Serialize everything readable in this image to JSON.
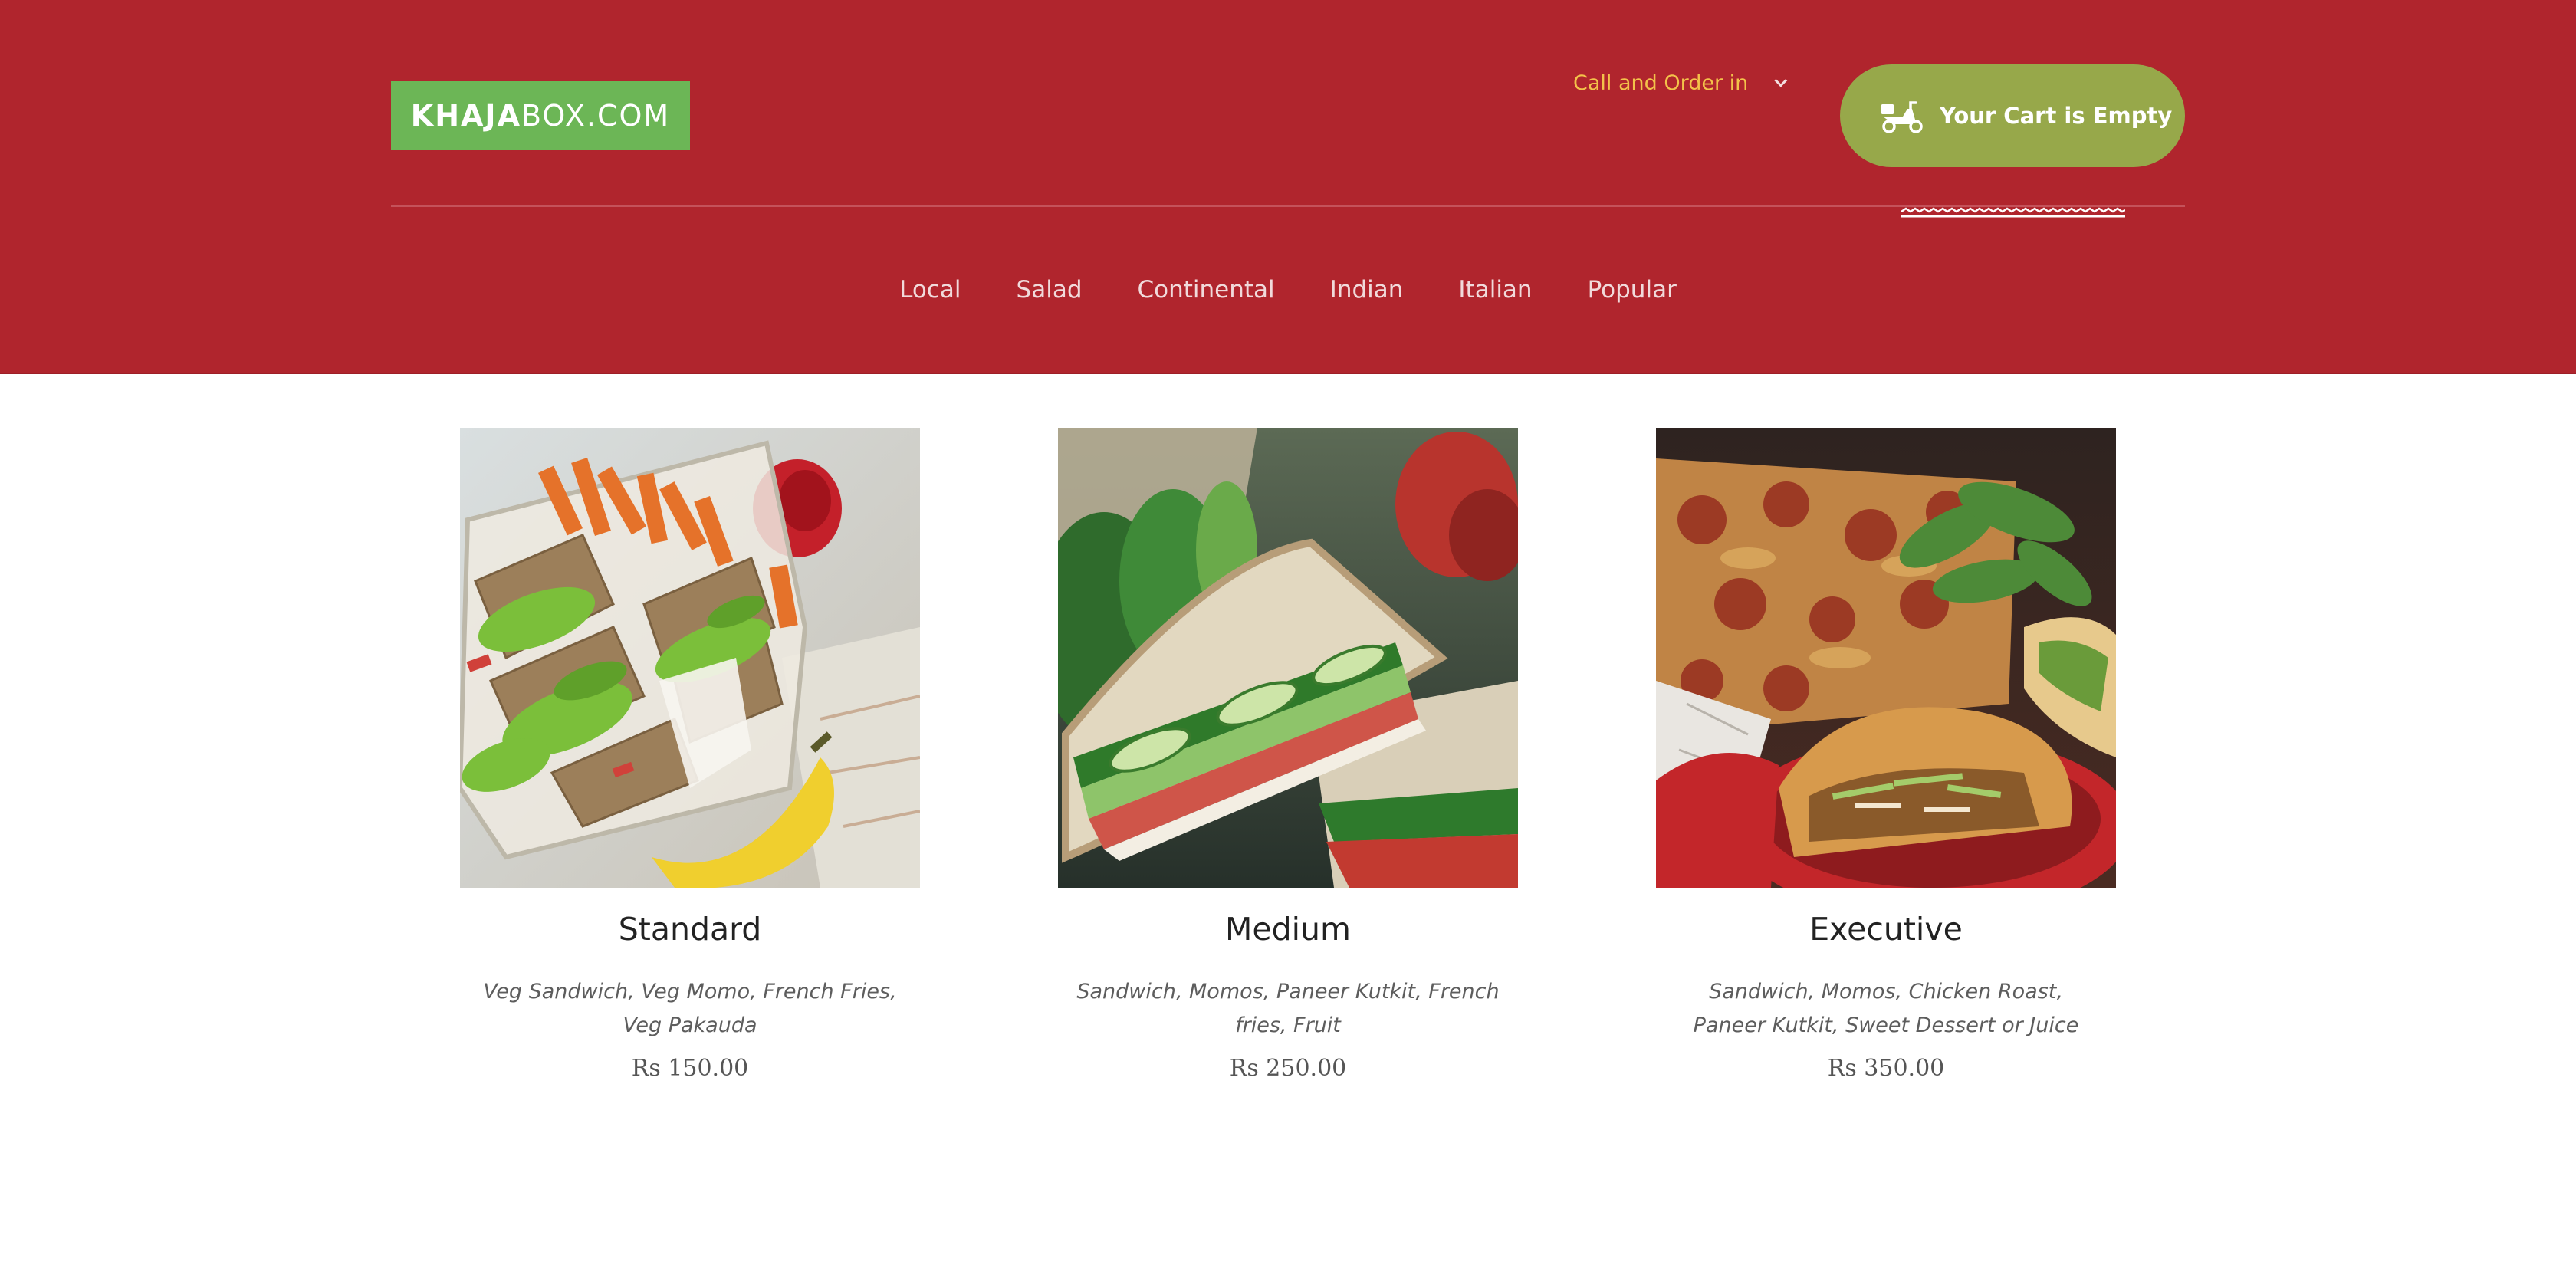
{
  "header": {
    "logo": {
      "bold": "KHAJA",
      "light": "BOX.COM"
    },
    "call_order": "Call and Order in",
    "cart_label": "Your Cart is Empty",
    "nav": [
      "Local",
      "Salad",
      "Continental",
      "Indian",
      "Italian",
      "Popular"
    ]
  },
  "products": [
    {
      "name": "Standard",
      "description": "Veg Sandwich, Veg Momo, French Fries, Veg Pakauda",
      "price": "Rs 150.00",
      "image": "sandwich-lunchbox-photo"
    },
    {
      "name": "Medium",
      "description": "Sandwich, Momos, Paneer Kutkit, French fries, Fruit",
      "price": "Rs 250.00",
      "image": "cucumber-tomato-sandwich-photo"
    },
    {
      "name": "Executive",
      "description": "Sandwich, Momos, Chicken Roast, Paneer Kutkit, Sweet Dessert or Juice",
      "price": "Rs 350.00",
      "image": "pizza-and-burrito-photo"
    }
  ],
  "colors": {
    "header_bg": "#b0252d",
    "logo_bg": "#6cb656",
    "cart_bg": "#97a84a",
    "call_order_text": "#f3c24a"
  },
  "icons": {
    "cart": "scooter-icon",
    "call_order": "chevron-down-icon"
  }
}
